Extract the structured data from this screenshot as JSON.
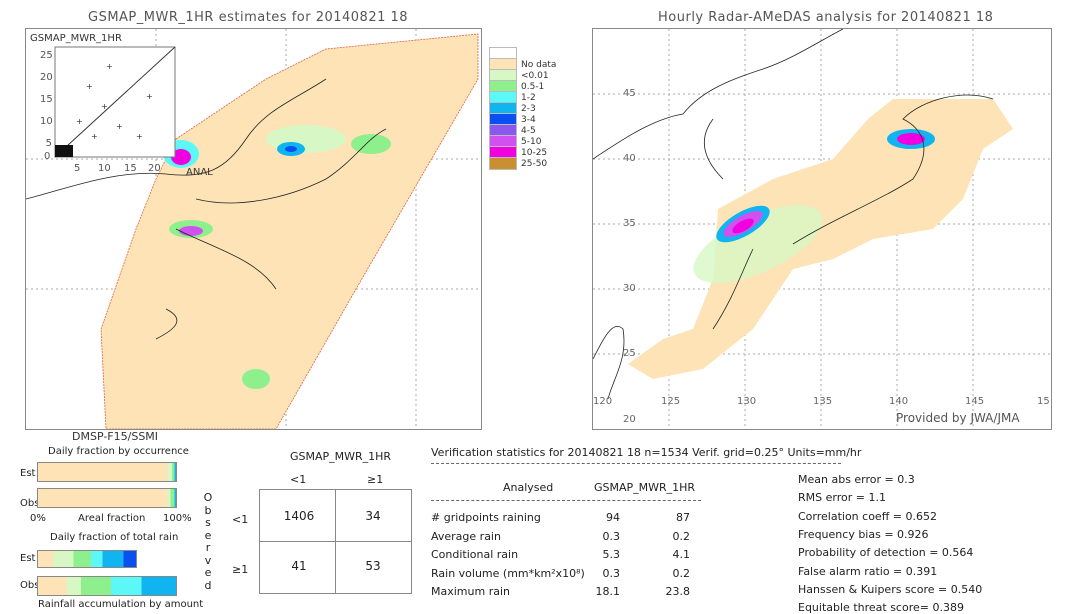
{
  "left_map": {
    "title": "GSMAP_MWR_1HR estimates for 20140821 18",
    "inset_label": "GSMAP_MWR_1HR",
    "inset_y_ticks": [
      "25",
      "20",
      "15",
      "10",
      "5",
      "0"
    ],
    "inset_x_ticks": [
      "5",
      "10",
      "15",
      "20"
    ],
    "anal_label": "ANAL",
    "satellite": "DMSP-F15/SSMI"
  },
  "legend": {
    "items": [
      {
        "label": "",
        "color": "#ffffff"
      },
      {
        "label": "No data",
        "color": "#fde3b5"
      },
      {
        "label": "<0.01",
        "color": "#d7f8c4"
      },
      {
        "label": "0.5-1",
        "color": "#8ef08c"
      },
      {
        "label": "1-2",
        "color": "#5cf8f8"
      },
      {
        "label": "2-3",
        "color": "#10b4f0"
      },
      {
        "label": "3-4",
        "color": "#0a50f0"
      },
      {
        "label": "4-5",
        "color": "#8a58f0"
      },
      {
        "label": "5-10",
        "color": "#d050f0"
      },
      {
        "label": "10-25",
        "color": "#f000e0"
      },
      {
        "label": "25-50",
        "color": "#c89030"
      }
    ]
  },
  "right_map": {
    "title": "Hourly Radar-AMeDAS analysis for 20140821 18",
    "lat_ticks": [
      "45",
      "40",
      "35",
      "30",
      "25",
      "20"
    ],
    "lon_ticks": [
      "120",
      "125",
      "130",
      "135",
      "140",
      "145",
      "15"
    ],
    "credit": "Provided by JWA/JMA"
  },
  "occurrence": {
    "title": "Daily fraction by occurrence",
    "est_label": "Est",
    "obs_label": "Obs",
    "axis_left": "0%",
    "axis_mid": "Areal fraction",
    "axis_right": "100%"
  },
  "total_rain": {
    "title": "Daily fraction of total rain",
    "est_label": "Est",
    "obs_label": "Obs",
    "footer": "Rainfall accumulation by amount"
  },
  "contingency": {
    "header": "GSMAP_MWR_1HR",
    "col_labels": [
      "<1",
      "≥1"
    ],
    "row_labels": [
      "<1",
      "≥1"
    ],
    "side_label": "Observed",
    "cells": [
      [
        "1406",
        "34"
      ],
      [
        "41",
        "53"
      ]
    ]
  },
  "stats": {
    "header": "Verification statistics for 20140821 18  n=1534  Verif. grid=0.25°  Units=mm/hr",
    "col_analysed": "Analysed",
    "col_est": "GSMAP_MWR_1HR",
    "rows": [
      {
        "label": "# gridpoints raining",
        "a": "94",
        "e": "87"
      },
      {
        "label": "Average rain",
        "a": "0.3",
        "e": "0.2"
      },
      {
        "label": "Conditional rain",
        "a": "5.3",
        "e": "4.1"
      },
      {
        "label": "Rain volume (mm*km²x10⁸)",
        "a": "0.3",
        "e": "0.2"
      },
      {
        "label": "Maximum rain",
        "a": "18.1",
        "e": "23.8"
      }
    ],
    "scores": [
      "Mean abs error = 0.3",
      "RMS error = 1.1",
      "Correlation coeff = 0.652",
      "Frequency bias = 0.926",
      "Probability of detection = 0.564",
      "False alarm ratio = 0.391",
      "Hanssen & Kuipers score = 0.540",
      "Equitable threat score= 0.389"
    ]
  }
}
